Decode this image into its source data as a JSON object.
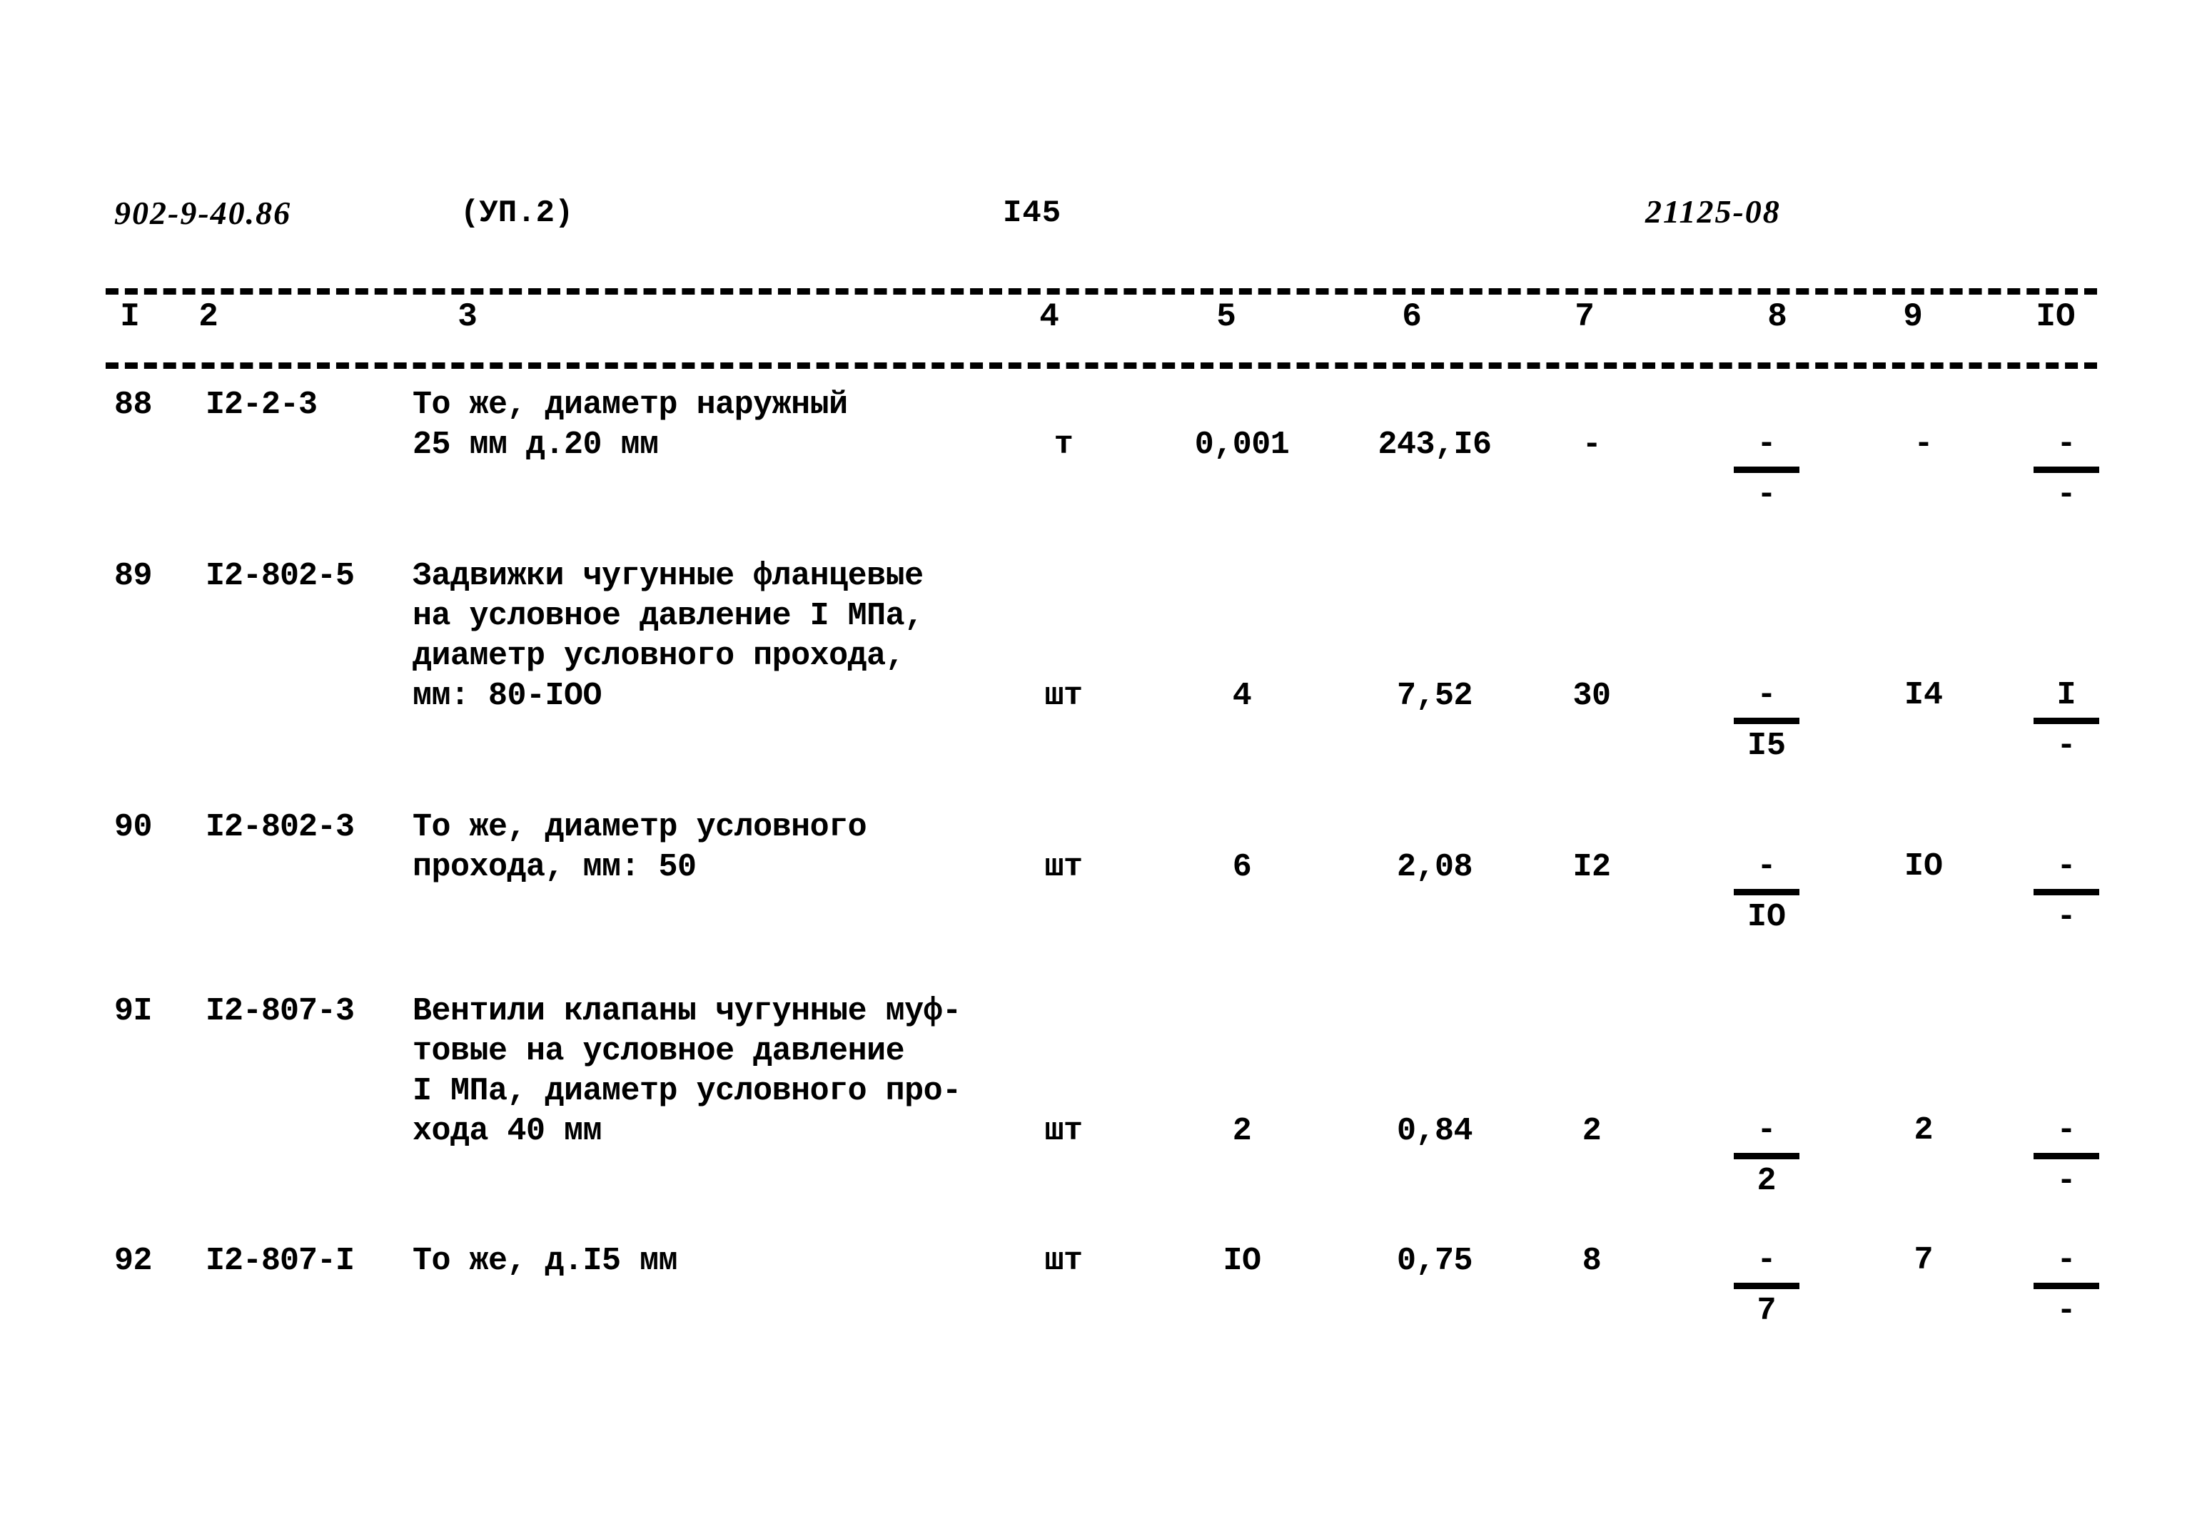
{
  "header": {
    "doc_code": "902-9-40.86",
    "part": "(УП.2)",
    "page_number": "I45",
    "stamp": "21125-08"
  },
  "table": {
    "column_numbers": [
      "I",
      "2",
      "3",
      "4",
      "5",
      "6",
      "7",
      "8",
      "9",
      "IO"
    ],
    "rows": [
      {
        "num": "88",
        "code": "I2-2-3",
        "description": "То же, диаметр наружный\n25 мм д.20 мм",
        "unit": "т",
        "qty": "0,001",
        "mass": "243,I6",
        "col7": "-",
        "col8_numer": "-",
        "col8_denom": "-",
        "col9_numer": "-",
        "col9_denom": "",
        "col10_numer": "-",
        "col10_denom": "-"
      },
      {
        "num": "89",
        "code": "I2-802-5",
        "description": "Задвижки чугунные фланцевые\nна условное давление I МПа,\nдиаметр условного прохода,\nмм: 80-IOO",
        "unit": "шт",
        "qty": "4",
        "mass": "7,52",
        "col7": "30",
        "col8_numer": "-",
        "col8_denom": "I5",
        "col9_numer": "I4",
        "col9_denom": "",
        "col10_numer": "I",
        "col10_denom": "-"
      },
      {
        "num": "90",
        "code": "I2-802-3",
        "description": "То же, диаметр условного\nпрохода, мм: 50",
        "unit": "шт",
        "qty": "6",
        "mass": "2,08",
        "col7": "I2",
        "col8_numer": "-",
        "col8_denom": "IO",
        "col9_numer": "IO",
        "col9_denom": "",
        "col10_numer": "-",
        "col10_denom": "-"
      },
      {
        "num": "9I",
        "code": "I2-807-3",
        "description": "Вентили клапаны чугунные муф-\nтовые на условное давление\nI МПа, диаметр условного про-\nхода 40 мм",
        "unit": "шт",
        "qty": "2",
        "mass": "0,84",
        "col7": "2",
        "col8_numer": "-",
        "col8_denom": "2",
        "col9_numer": "2",
        "col9_denom": "",
        "col10_numer": "-",
        "col10_denom": "-"
      },
      {
        "num": "92",
        "code": "I2-807-I",
        "description": "То же, д.I5 мм",
        "unit": "шт",
        "qty": "IO",
        "mass": "0,75",
        "col7": "8",
        "col8_numer": "-",
        "col8_denom": "7",
        "col9_numer": "7",
        "col9_denom": "",
        "col10_numer": "-",
        "col10_denom": "-"
      }
    ]
  }
}
